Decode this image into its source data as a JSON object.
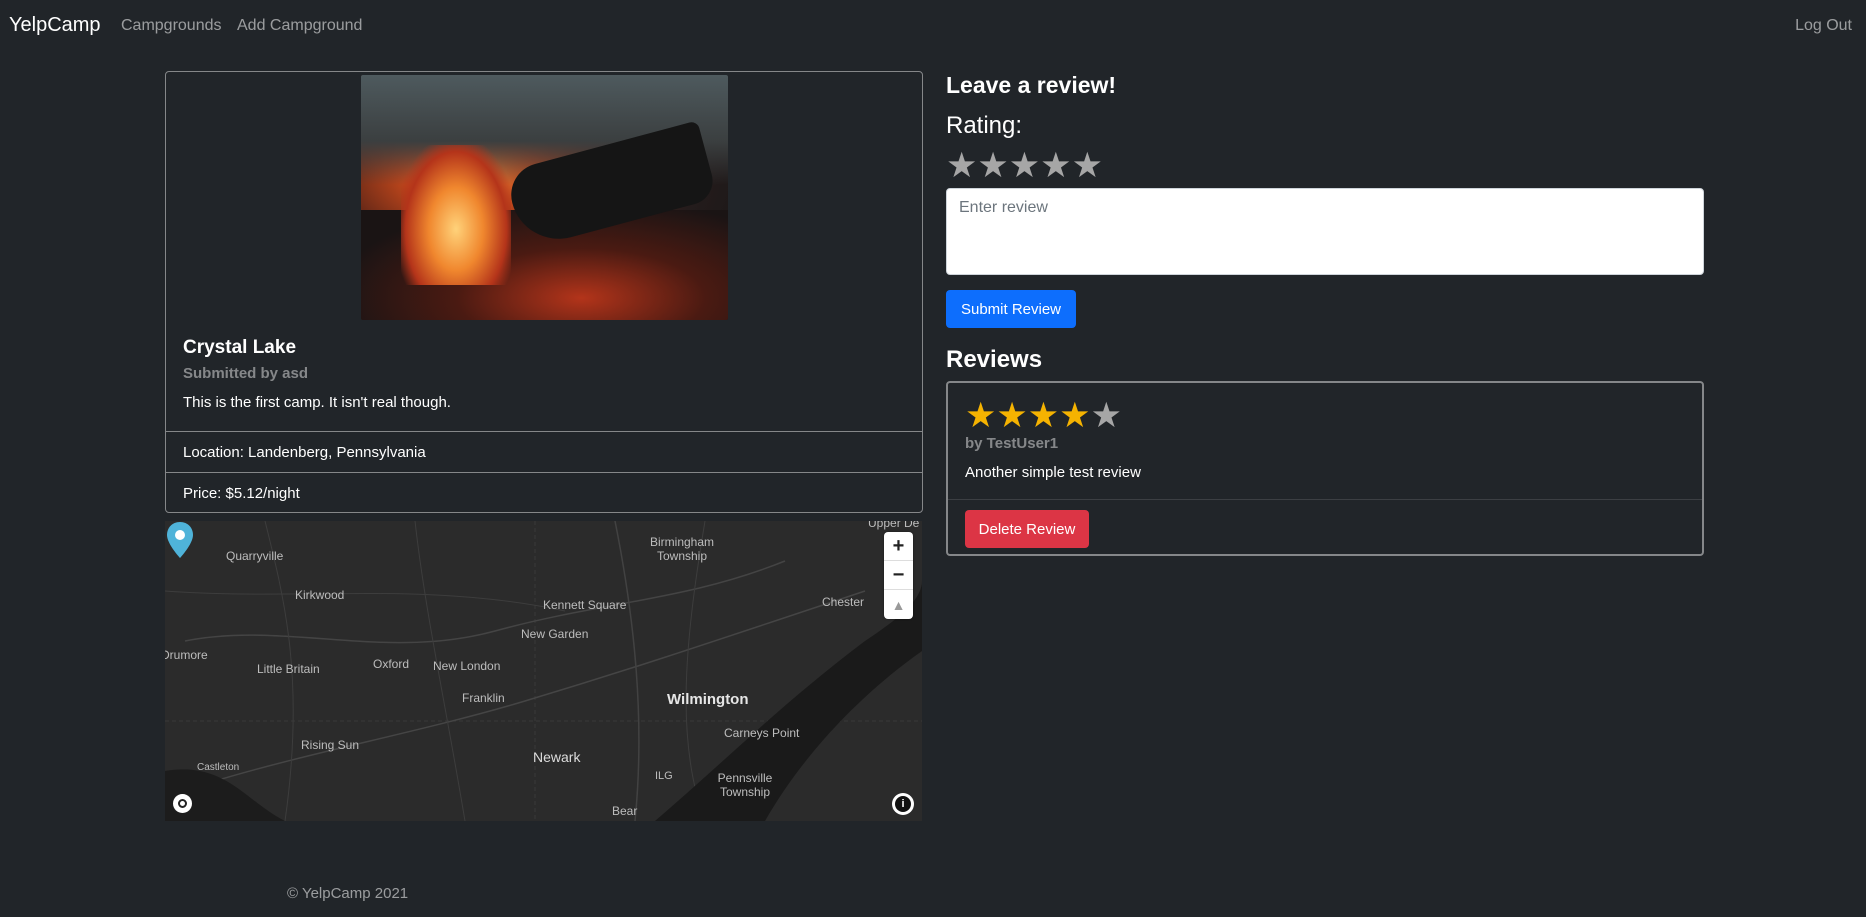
{
  "navbar": {
    "brand": "YelpCamp",
    "links": [
      "Campgrounds",
      "Add Campground"
    ],
    "logout": "Log Out"
  },
  "campground": {
    "image_alt": "campfire",
    "title": "Crystal Lake",
    "submitted_by": "Submitted by asd",
    "description": "This is the first camp. It isn't real though.",
    "location": "Location: Landenberg, Pennsylvania",
    "price": "Price: $5.12/night"
  },
  "map": {
    "labels": {
      "quarryville": "Quarryville",
      "kirkwood": "Kirkwood",
      "birmingham": "Birmingham Township",
      "kennett": "Kennett Square",
      "chester": "Chester",
      "upper": "Upper De",
      "newgarden": "New Garden",
      "drumore": "Drumore",
      "littlebritain": "Little Britain",
      "oxford": "Oxford",
      "newlondon": "New London",
      "franklin": "Franklin",
      "wilmington": "Wilmington",
      "carneys": "Carneys Point",
      "risingsun": "Rising Sun",
      "newark": "Newark",
      "castleton": "Castleton",
      "ilg": "ILG",
      "pennsville": "Pennsville Township",
      "bear": "Bear"
    },
    "zoom_in": "+",
    "zoom_out": "−",
    "compass": "▲"
  },
  "review_form": {
    "heading": "Leave a review!",
    "rating_label": "Rating:",
    "rating_value": 0,
    "max_rating": 5,
    "placeholder": "Enter review",
    "submit_label": "Submit Review"
  },
  "reviews": {
    "heading": "Reviews",
    "items": [
      {
        "rating": 4,
        "author": "by TestUser1",
        "body": "Another simple test review",
        "delete_label": "Delete Review"
      }
    ]
  },
  "footer": {
    "text": "© YelpCamp 2021"
  },
  "colors": {
    "background": "#212529",
    "primary": "#0d6efd",
    "danger": "#dc3545",
    "star_on": "#f5b301",
    "star_off": "#a6a6a6"
  }
}
